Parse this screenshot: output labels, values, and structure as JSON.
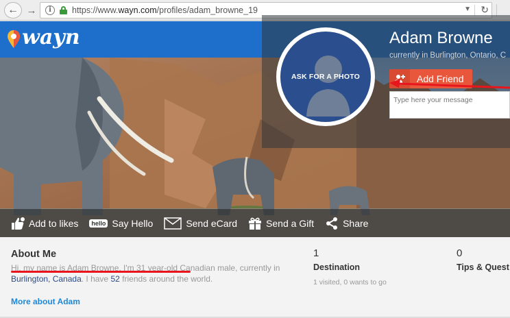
{
  "browser": {
    "url_prefix": "https://www.",
    "url_domain": "wayn.com",
    "url_path": "/profiles/adam_browne_19"
  },
  "header": {
    "logo_text": "wayn"
  },
  "profile": {
    "name": "Adam Browne",
    "location": "currently in Burlington, Ontario, C",
    "avatar_label": "ASK FOR A PHOTO",
    "add_friend_label": "Add Friend",
    "message_placeholder": "Type here your message"
  },
  "actions": [
    {
      "label": "Add to likes"
    },
    {
      "label": "Say Hello",
      "badge": "hello"
    },
    {
      "label": "Send eCard"
    },
    {
      "label": "Send a Gift"
    },
    {
      "label": "Share"
    }
  ],
  "about": {
    "title": "About Me",
    "text_1": "Hi, my name is Adam Browne. I'm 31 year-old Canadian male, currently in",
    "text_loc": "Burlington, Canada",
    "text_2": ". I have ",
    "text_count": "52",
    "text_3": " friends around the world.",
    "more_link": "More about Adam"
  },
  "stats": [
    {
      "number": "1",
      "label": "Destination",
      "sub": "1 visited, 0 wants to go"
    },
    {
      "number": "0",
      "label": "Tips & Quest",
      "sub": ""
    }
  ],
  "colors": {
    "brand_blue": "#1d6fcb",
    "add_friend": "#e8573c",
    "link": "#1d88d8",
    "annotation_red": "#e8161c"
  }
}
